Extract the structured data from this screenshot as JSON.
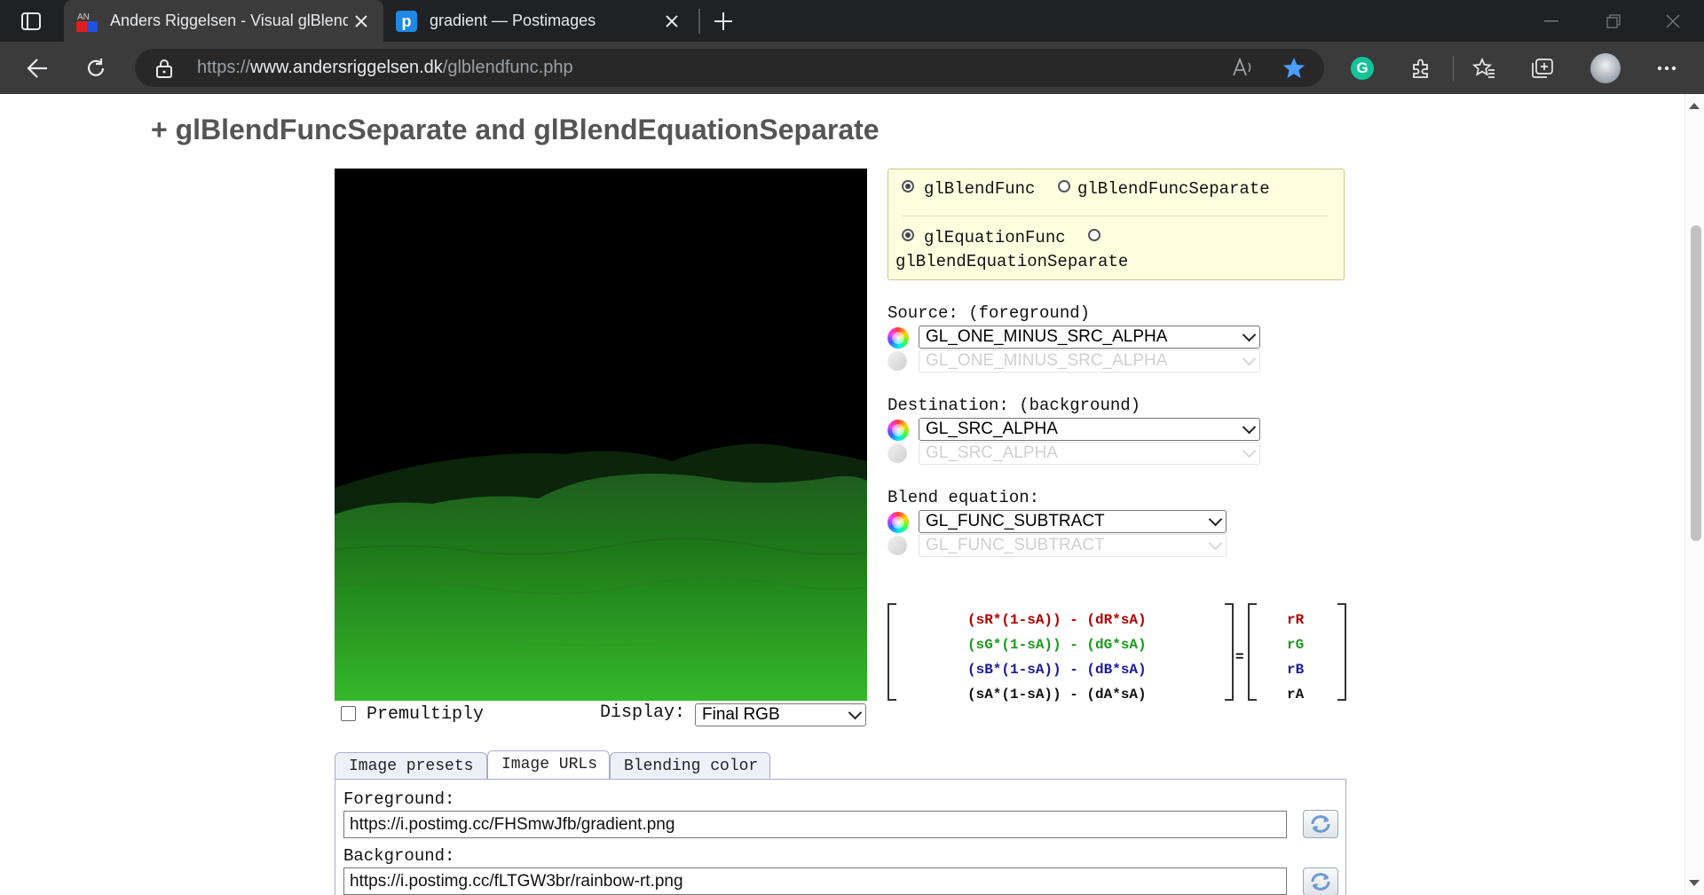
{
  "browser": {
    "tabs": [
      {
        "title": "Anders Riggelsen - Visual glBlendFunc + glBlendEquation Tool",
        "favicon": "AN"
      },
      {
        "title": "gradient — Postimages",
        "favicon": "p"
      }
    ],
    "url": {
      "scheme": "https://",
      "host": "www.andersriggelsen.dk",
      "path": "/glblendfunc.php"
    }
  },
  "page": {
    "section_title": "+ glBlendFuncSeparate and glBlendEquationSeparate",
    "mode": {
      "func_option": "glBlendFunc",
      "func_separate_option": "glBlendFuncSeparate",
      "equation_option": "glEquationFunc",
      "equation_separate_option": "glBlendEquationSeparate",
      "func_selected": "glBlendFunc",
      "equation_selected": "glEquationFunc"
    },
    "source": {
      "label": "Source: (foreground)",
      "rgb": "GL_ONE_MINUS_SRC_ALPHA",
      "alpha": "GL_ONE_MINUS_SRC_ALPHA"
    },
    "destination": {
      "label": "Destination: (background)",
      "rgb": "GL_SRC_ALPHA",
      "alpha": "GL_SRC_ALPHA"
    },
    "equation": {
      "label": "Blend equation:",
      "rgb": "GL_FUNC_SUBTRACT",
      "alpha": "GL_FUNC_SUBTRACT"
    },
    "formula": {
      "lines": [
        "(sR*(1-sA)) - (dR*sA)",
        "(sG*(1-sA)) - (dG*sA)",
        "(sB*(1-sA)) - (dB*sA)",
        "(sA*(1-sA)) - (dA*sA)"
      ],
      "equals": "=",
      "results": [
        "rR",
        "rG",
        "rB",
        "rA"
      ],
      "colors": [
        "#b00000",
        "#1a9a1a",
        "#1a1a9a",
        "#111111"
      ]
    },
    "premultiply_label": "Premultiply",
    "premultiply_checked": false,
    "display_label": "Display:",
    "display_value": "Final RGB",
    "tabs": [
      "Image presets",
      "Image URLs",
      "Blending color"
    ],
    "active_tab": "Image URLs",
    "foreground_label": "Foreground:",
    "foreground_url": "https://i.postimg.cc/FHSmwJfb/gradient.png",
    "background_label": "Background:",
    "background_url": "https://i.postimg.cc/fLTGW3br/rainbow-rt.png"
  },
  "colors": {
    "chrome_bg": "#202124",
    "toolbar_bg": "#3b3b3b",
    "mode_box_bg": "#ffffe0",
    "accent_star": "#4a9eff",
    "grammarly": "#15c39a"
  }
}
